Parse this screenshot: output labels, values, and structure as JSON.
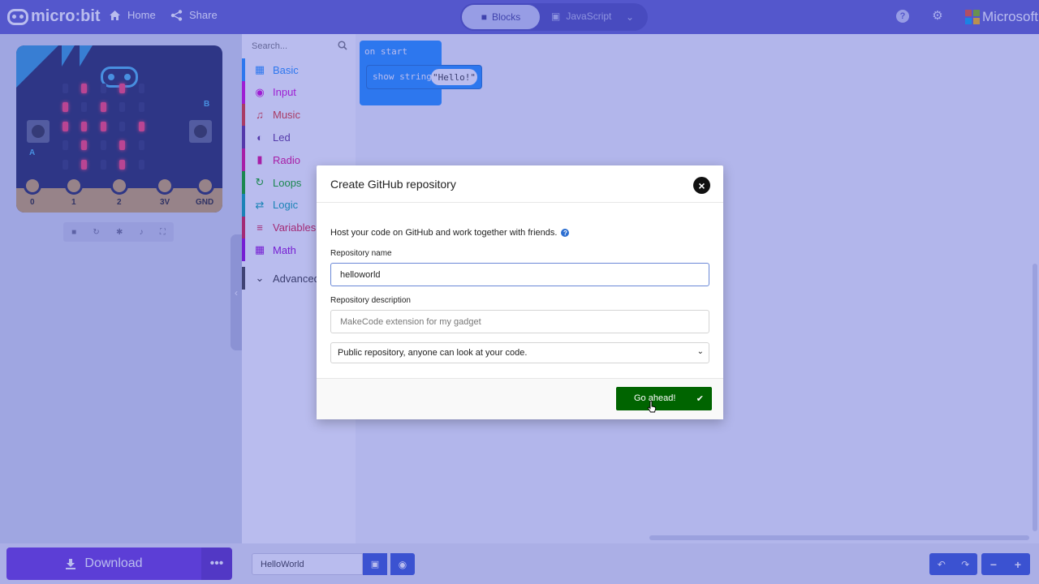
{
  "header": {
    "brand": "micro:bit",
    "home_label": "Home",
    "share_label": "Share",
    "mode_blocks": "Blocks",
    "mode_javascript": "JavaScript",
    "microsoft_label": "Microsoft"
  },
  "board": {
    "letter_a": "A",
    "letter_b": "B",
    "pins": [
      "0",
      "1",
      "2",
      "3V",
      "GND"
    ],
    "leds_on": [
      [
        0,
        1
      ],
      [
        0,
        3
      ],
      [
        1,
        0
      ],
      [
        1,
        2
      ],
      [
        2,
        0
      ],
      [
        2,
        1
      ],
      [
        2,
        2
      ],
      [
        2,
        4
      ],
      [
        3,
        1
      ],
      [
        3,
        3
      ],
      [
        4,
        1
      ],
      [
        4,
        3
      ]
    ]
  },
  "toolbox": {
    "search_placeholder": "Search...",
    "categories": [
      {
        "label": "Basic",
        "color": "#1e90ff",
        "icon": "grid-icon"
      },
      {
        "label": "Input",
        "color": "#d400d4",
        "icon": "target-icon"
      },
      {
        "label": "Music",
        "color": "#e63022",
        "icon": "headphones-icon"
      },
      {
        "label": "Led",
        "color": "#5c2d91",
        "icon": "toggle-icon"
      },
      {
        "label": "Radio",
        "color": "#e3008c",
        "icon": "signal-icon"
      },
      {
        "label": "Loops",
        "color": "#00aa00",
        "icon": "refresh-icon"
      },
      {
        "label": "Logic",
        "color": "#00a4a6",
        "icon": "shuffle-icon"
      },
      {
        "label": "Variables",
        "color": "#dc143c",
        "icon": "list-icon"
      },
      {
        "label": "Math",
        "color": "#9400d3",
        "icon": "calculator-icon"
      }
    ],
    "advanced_label": "Advanced"
  },
  "workspace": {
    "on_start_label": "on start",
    "show_string_label": "show string",
    "string_value": "\"Hello!\""
  },
  "download": {
    "label": "Download",
    "more_label": "•••"
  },
  "bottombar": {
    "project_name": "HelloWorld"
  },
  "modal": {
    "title": "Create GitHub repository",
    "description": "Host your code on GitHub and work together with friends.",
    "repo_name_label": "Repository name",
    "repo_name_value": "helloworld",
    "repo_desc_label": "Repository description",
    "repo_desc_placeholder": "MakeCode extension for my gadget",
    "visibility_value": "Public repository, anyone can look at your code.",
    "go_label": "Go ahead!"
  },
  "colors": {
    "header": "#5c5cc9",
    "go_button": "#006400",
    "download": "#6a35d9",
    "block": "#1e90ff"
  }
}
